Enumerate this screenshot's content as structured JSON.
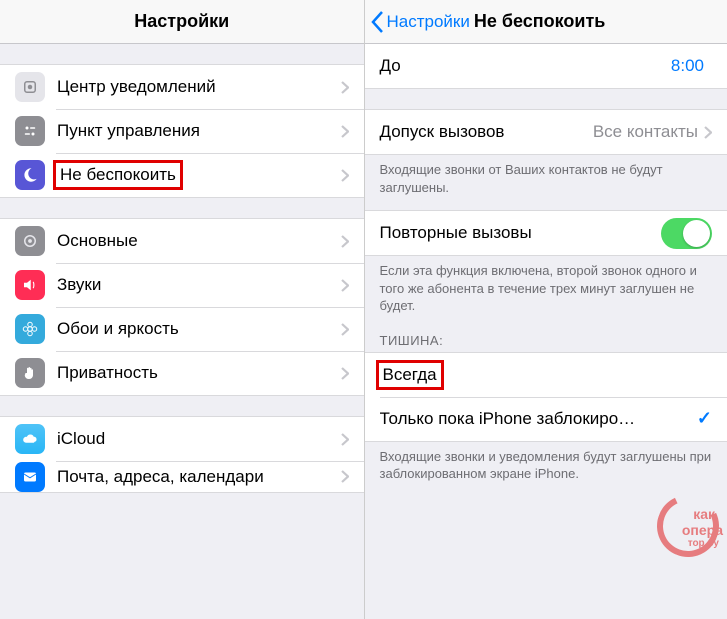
{
  "left": {
    "title": "Настройки",
    "groups": {
      "g1": [
        {
          "label": "Центр уведомлений"
        },
        {
          "label": "Пункт управления"
        },
        {
          "label": "Не беспокоить",
          "highlight": true
        }
      ],
      "g2": [
        {
          "label": "Основные"
        },
        {
          "label": "Звуки"
        },
        {
          "label": "Обои и яркость"
        },
        {
          "label": "Приватность"
        }
      ],
      "g3": [
        {
          "label": "iCloud"
        },
        {
          "label": "Почта, адреса, календари"
        }
      ]
    }
  },
  "right": {
    "back": "Настройки",
    "title": "Не беспокоить",
    "to_label": "До",
    "to_time": "8:00",
    "allow_label": "Допуск вызовов",
    "allow_value": "Все контакты",
    "allow_footer": "Входящие звонки от Ваших контактов не будут заглушены.",
    "repeat_label": "Повторные вызовы",
    "repeat_footer": "Если эта функция включена, второй звонок одного и того же абонента в течение трех минут заглушен не будет.",
    "silence_header": "ТИШИНА:",
    "opt_always": "Всегда",
    "opt_locked": "Только пока iPhone заблокиро…",
    "silence_footer": "Входящие звонки и уведомления будут заглушены при заблокированном экране iPhone."
  },
  "watermark": {
    "l1": "как",
    "l2": "опера",
    "l3": "тор.ру"
  }
}
